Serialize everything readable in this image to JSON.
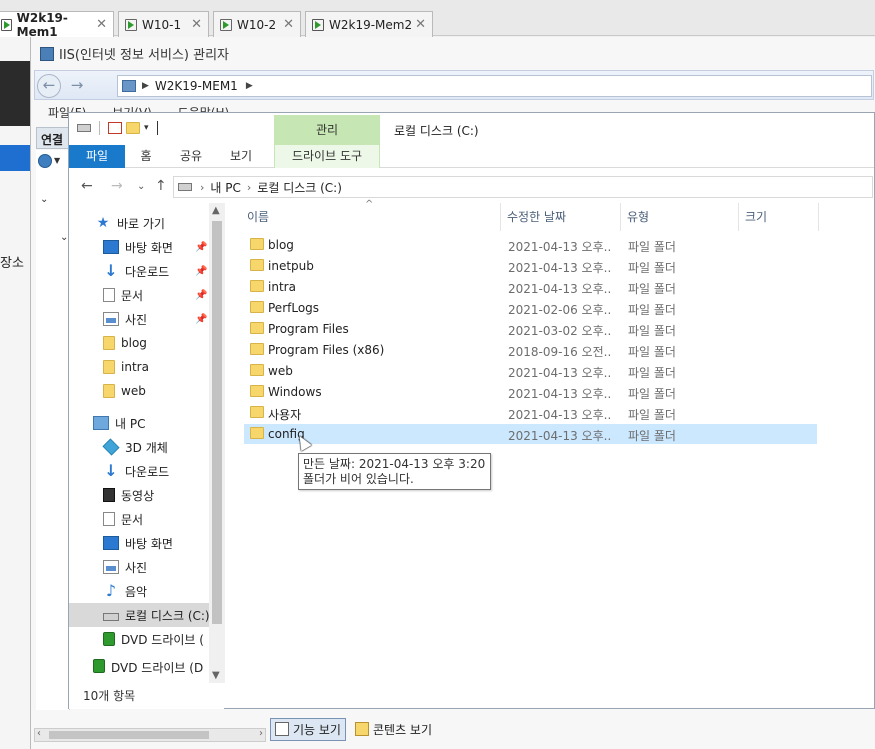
{
  "host_tabs": [
    {
      "label": "W2k19-Mem1",
      "active": true
    },
    {
      "label": "W10-1",
      "active": false
    },
    {
      "label": "W10-2",
      "active": false
    },
    {
      "label": "W2k19-Mem2",
      "active": false
    }
  ],
  "host_left_label": "장소",
  "iis": {
    "title": "IIS(인터넷 정보 서비스) 관리자",
    "path": "W2K19-MEM1",
    "menu": [
      "파일(F)",
      "보기(V)",
      "도움말(H)"
    ],
    "connections_label": "연결",
    "view_features": "기능 보기",
    "view_content": "콘텐츠 보기"
  },
  "explorer": {
    "title": "로컬 디스크 (C:)",
    "context_tab_group": "관리",
    "ribbon_tabs": [
      "파일",
      "홈",
      "공유",
      "보기",
      "드라이브 도구"
    ],
    "breadcrumb": [
      "내 PC",
      "로컬 디스크 (C:)"
    ],
    "quick_access_label": "바로 가기",
    "quick_access": [
      {
        "label": "바탕 화면",
        "icon": "desktop-icon",
        "pinned": true
      },
      {
        "label": "다운로드",
        "icon": "download-icon",
        "pinned": true
      },
      {
        "label": "문서",
        "icon": "document-icon",
        "pinned": true
      },
      {
        "label": "사진",
        "icon": "pictures-icon",
        "pinned": true
      },
      {
        "label": "blog",
        "icon": "folder-icon",
        "pinned": false
      },
      {
        "label": "intra",
        "icon": "folder-icon",
        "pinned": false
      },
      {
        "label": "web",
        "icon": "folder-icon",
        "pinned": false
      }
    ],
    "this_pc_label": "내 PC",
    "this_pc": [
      {
        "label": "3D 개체",
        "icon": "3d-objects-icon"
      },
      {
        "label": "다운로드",
        "icon": "download-icon"
      },
      {
        "label": "동영상",
        "icon": "video-icon"
      },
      {
        "label": "문서",
        "icon": "document-icon"
      },
      {
        "label": "바탕 화면",
        "icon": "desktop-icon"
      },
      {
        "label": "사진",
        "icon": "pictures-icon"
      },
      {
        "label": "음악",
        "icon": "music-icon"
      },
      {
        "label": "로컬 디스크 (C:)",
        "icon": "drive-icon"
      },
      {
        "label": "DVD 드라이브 (",
        "icon": "dvd-icon"
      },
      {
        "label": "DVD 드라이브 (D",
        "icon": "dvd-icon"
      }
    ],
    "status": "10개 항목",
    "columns": [
      "이름",
      "수정한 날짜",
      "유형",
      "크기"
    ],
    "files": [
      {
        "name": "blog",
        "date": "2021-04-13 오후...",
        "type": "파일 폴더"
      },
      {
        "name": "inetpub",
        "date": "2021-04-13 오후...",
        "type": "파일 폴더"
      },
      {
        "name": "intra",
        "date": "2021-04-13 오후...",
        "type": "파일 폴더"
      },
      {
        "name": "PerfLogs",
        "date": "2021-02-06 오후...",
        "type": "파일 폴더"
      },
      {
        "name": "Program Files",
        "date": "2021-03-02 오후...",
        "type": "파일 폴더"
      },
      {
        "name": "Program Files (x86)",
        "date": "2018-09-16 오전...",
        "type": "파일 폴더"
      },
      {
        "name": "web",
        "date": "2021-04-13 오후...",
        "type": "파일 폴더"
      },
      {
        "name": "Windows",
        "date": "2021-04-13 오후...",
        "type": "파일 폴더"
      },
      {
        "name": "사용자",
        "date": "2021-04-13 오후...",
        "type": "파일 폴더"
      },
      {
        "name": "config",
        "date": "2021-04-13 오후...",
        "type": "파일 폴더"
      }
    ],
    "tooltip": {
      "line1": "만든 날짜: 2021-04-13 오후 3:20",
      "line2": "폴더가 비어 있습니다."
    }
  },
  "colors": {
    "ribbon_file_tab": "#1979ca",
    "context_tab": "#c6e6b3",
    "row_hover": "#cce8ff",
    "folder": "#f7d66b",
    "host_selection": "#1f6fd0"
  }
}
